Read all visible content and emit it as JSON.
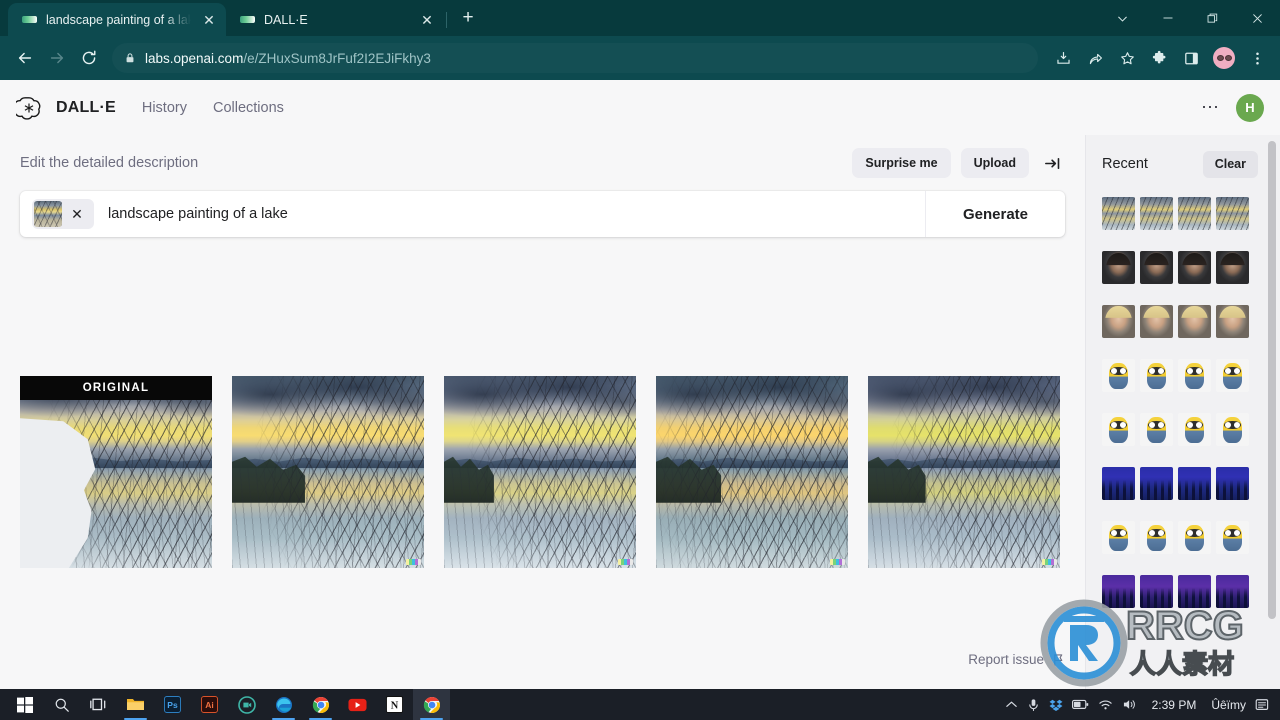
{
  "browser": {
    "tabs": [
      {
        "title": "landscape painting of a lake | DALL·E",
        "close_label": "✕",
        "active": true
      },
      {
        "title": "DALL·E",
        "close_label": "✕",
        "active": false
      }
    ],
    "new_tab_label": "+",
    "window_controls": {
      "chevron": "⌄",
      "minimize": "—",
      "restore": "❐",
      "close": "✕"
    },
    "address": {
      "scheme_host": "labs.openai.com",
      "path": "/e/ZHuxSum8JrFuf2I2EJiFkhy3"
    },
    "toolbar_icons": [
      "back-arrow",
      "forward-arrow",
      "reload",
      "lock",
      "install",
      "share",
      "bookmark-star",
      "extensions-puzzle",
      "side-panel",
      "profile-avatar",
      "chrome-menu"
    ]
  },
  "app": {
    "brand": "DALL·E",
    "nav": [
      {
        "label": "History"
      },
      {
        "label": "Collections"
      }
    ],
    "overflow_menu": "⋯",
    "avatar_initial": "H"
  },
  "prompt": {
    "header_label": "Edit the detailed description",
    "surprise_label": "Surprise me",
    "upload_label": "Upload",
    "collapse_icon": "collapse-right-icon",
    "chip_remove_label": "✕",
    "text": "landscape painting of a lake",
    "placeholder": "Edit the detailed description",
    "generate_label": "Generate"
  },
  "results": {
    "original_label": "ORIGINAL",
    "cards": [
      {
        "variant": "v1",
        "is_original": true,
        "has_badge": false
      },
      {
        "variant": "v2",
        "is_original": false,
        "has_badge": true
      },
      {
        "variant": "v3",
        "is_original": false,
        "has_badge": true
      },
      {
        "variant": "v4",
        "is_original": false,
        "has_badge": true
      },
      {
        "variant": "v5",
        "is_original": false,
        "has_badge": true
      }
    ],
    "report_label": "Report issue",
    "report_icon": "flag-icon"
  },
  "sidebar": {
    "title": "Recent",
    "clear_label": "Clear",
    "rows": [
      {
        "kind": "lake",
        "count": 4
      },
      {
        "kind": "woman",
        "count": 4
      },
      {
        "kind": "blonde",
        "count": 4
      },
      {
        "kind": "minion",
        "count": 4
      },
      {
        "kind": "minion",
        "count": 4
      },
      {
        "kind": "city",
        "count": 4
      },
      {
        "kind": "minion",
        "count": 4
      },
      {
        "kind": "city-purple",
        "count": 4
      }
    ]
  },
  "taskbar": {
    "apps": [
      {
        "name": "start-windows",
        "open": false
      },
      {
        "name": "search",
        "open": false
      },
      {
        "name": "task-view",
        "open": false
      },
      {
        "name": "file-explorer",
        "open": true
      },
      {
        "name": "photoshop",
        "open": false,
        "label": "Ps"
      },
      {
        "name": "illustrator",
        "open": false,
        "label": "Ai"
      },
      {
        "name": "camtasia",
        "open": false
      },
      {
        "name": "microsoft-edge",
        "open": true
      },
      {
        "name": "google-chrome",
        "open": true
      },
      {
        "name": "youtube",
        "open": false
      },
      {
        "name": "notion",
        "open": false,
        "label": "N"
      },
      {
        "name": "chrome-active",
        "open": true,
        "active": true
      }
    ],
    "tray": [
      "show-hidden-chevron",
      "microphone",
      "dropbox",
      "battery",
      "wifi",
      "volume"
    ],
    "time": "2:39 PM",
    "extra": "Ûêïmy"
  },
  "colors": {
    "browser_chrome": "#0d4a4f",
    "tabstrip": "#073a3d",
    "page_bg": "#f7f7f8",
    "sidebar_bg": "#f1f1f3",
    "accent_avatar": "#6aa84f",
    "taskbar": "#1b1f27",
    "watermark_blue": "#2b8fd6"
  }
}
